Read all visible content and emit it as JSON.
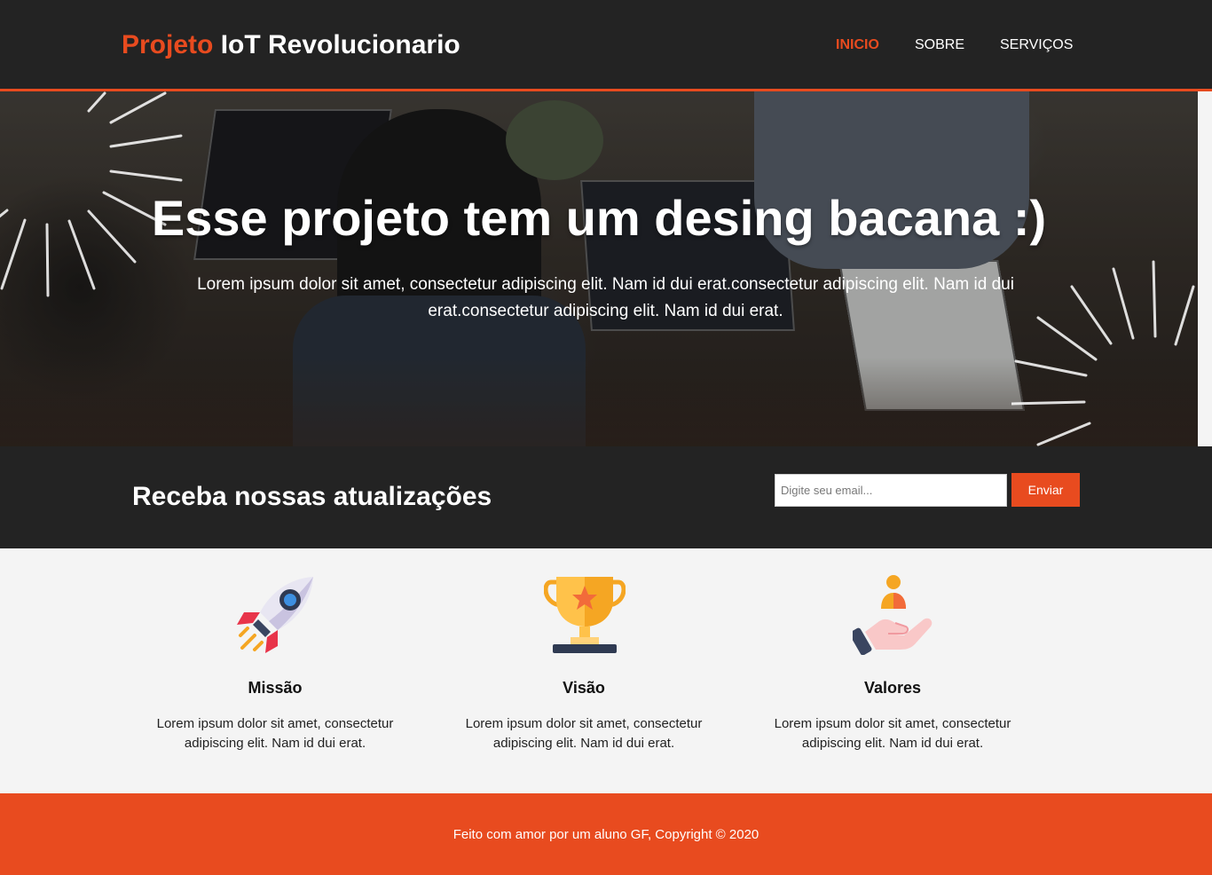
{
  "header": {
    "brand_highlight": "Projeto",
    "brand_rest": " IoT Revolucionario",
    "nav": [
      {
        "label": "INICIO",
        "active": true
      },
      {
        "label": "SOBRE",
        "active": false
      },
      {
        "label": "SERVIÇOS",
        "active": false
      }
    ]
  },
  "hero": {
    "title": "Esse projeto tem um desing bacana :)",
    "text": "Lorem ipsum dolor sit amet, consectetur adipiscing elit. Nam id dui erat.consectetur adipiscing elit. Nam id dui erat.consectetur adipiscing elit. Nam id dui erat."
  },
  "newsletter": {
    "title": "Receba nossas atualizações",
    "input_placeholder": "Digite seu email...",
    "button_label": "Enviar"
  },
  "features": [
    {
      "icon": "rocket-icon",
      "title": "Missão",
      "text": "Lorem ipsum dolor sit amet, consectetur adipiscing elit. Nam id dui erat."
    },
    {
      "icon": "trophy-icon",
      "title": "Visão",
      "text": "Lorem ipsum dolor sit amet, consectetur adipiscing elit. Nam id dui erat."
    },
    {
      "icon": "hand-person-icon",
      "title": "Valores",
      "text": "Lorem ipsum dolor sit amet, consectetur adipiscing elit. Nam id dui erat."
    }
  ],
  "footer": {
    "text": "Feito com amor por um aluno GF, Copyright © 2020"
  },
  "colors": {
    "accent": "#e84b1f",
    "dark": "#232323",
    "light_bg": "#f4f4f4"
  }
}
